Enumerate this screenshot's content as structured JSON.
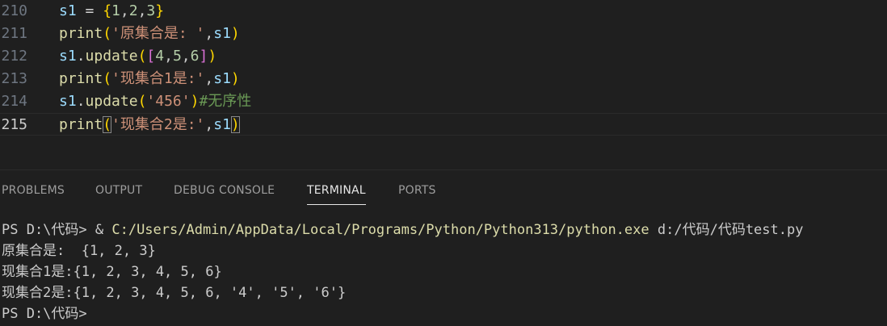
{
  "editor": {
    "lines": [
      {
        "number": "210",
        "tokens": [
          {
            "t": "s1",
            "c": "tok-var"
          },
          {
            "t": " = ",
            "c": "tok-op"
          },
          {
            "t": "{",
            "c": "tok-brace"
          },
          {
            "t": "1",
            "c": "tok-num"
          },
          {
            "t": ",",
            "c": "tok-punc"
          },
          {
            "t": "2",
            "c": "tok-num"
          },
          {
            "t": ",",
            "c": "tok-punc"
          },
          {
            "t": "3",
            "c": "tok-num"
          },
          {
            "t": "}",
            "c": "tok-brace"
          }
        ]
      },
      {
        "number": "211",
        "tokens": [
          {
            "t": "print",
            "c": "tok-fn"
          },
          {
            "t": "(",
            "c": "tok-brace"
          },
          {
            "t": "'原集合是: '",
            "c": "tok-str"
          },
          {
            "t": ",",
            "c": "tok-punc"
          },
          {
            "t": "s1",
            "c": "tok-var"
          },
          {
            "t": ")",
            "c": "tok-brace"
          }
        ]
      },
      {
        "number": "212",
        "tokens": [
          {
            "t": "s1",
            "c": "tok-var"
          },
          {
            "t": ".",
            "c": "tok-punc"
          },
          {
            "t": "update",
            "c": "tok-fn"
          },
          {
            "t": "(",
            "c": "tok-brace"
          },
          {
            "t": "[",
            "c": "tok-bracket2"
          },
          {
            "t": "4",
            "c": "tok-num"
          },
          {
            "t": ",",
            "c": "tok-punc"
          },
          {
            "t": "5",
            "c": "tok-num"
          },
          {
            "t": ",",
            "c": "tok-punc"
          },
          {
            "t": "6",
            "c": "tok-num"
          },
          {
            "t": "]",
            "c": "tok-bracket2"
          },
          {
            "t": ")",
            "c": "tok-brace"
          }
        ]
      },
      {
        "number": "213",
        "tokens": [
          {
            "t": "print",
            "c": "tok-fn"
          },
          {
            "t": "(",
            "c": "tok-brace"
          },
          {
            "t": "'现集合1是:'",
            "c": "tok-str"
          },
          {
            "t": ",",
            "c": "tok-punc"
          },
          {
            "t": "s1",
            "c": "tok-var"
          },
          {
            "t": ")",
            "c": "tok-brace"
          }
        ]
      },
      {
        "number": "214",
        "tokens": [
          {
            "t": "s1",
            "c": "tok-var"
          },
          {
            "t": ".",
            "c": "tok-punc"
          },
          {
            "t": "update",
            "c": "tok-fn"
          },
          {
            "t": "(",
            "c": "tok-brace"
          },
          {
            "t": "'456'",
            "c": "tok-str"
          },
          {
            "t": ")",
            "c": "tok-brace"
          },
          {
            "t": "#无序性",
            "c": "tok-comment"
          }
        ]
      },
      {
        "number": "215",
        "current": true,
        "tokens": [
          {
            "t": "print",
            "c": "tok-fn"
          },
          {
            "t": "(",
            "c": "tok-brace bracket-match"
          },
          {
            "t": "'现集合2是:'",
            "c": "tok-str"
          },
          {
            "t": ",",
            "c": "tok-punc"
          },
          {
            "t": "s1",
            "c": "tok-var"
          },
          {
            "t": ")",
            "c": "tok-brace bracket-match"
          }
        ]
      }
    ]
  },
  "panel": {
    "tabs": [
      {
        "label": "PROBLEMS",
        "active": false
      },
      {
        "label": "OUTPUT",
        "active": false
      },
      {
        "label": "DEBUG CONSOLE",
        "active": false
      },
      {
        "label": "TERMINAL",
        "active": true
      },
      {
        "label": "PORTS",
        "active": false
      }
    ]
  },
  "terminal": {
    "command_prompt": "PS D:\\代码> & ",
    "command_path": "C:/Users/Admin/AppData/Local/Programs/Python/Python313/python.exe",
    "command_args": " d:/代码/代码test.py",
    "output_lines": [
      "原集合是:  {1, 2, 3}",
      "现集合1是:{1, 2, 3, 4, 5, 6}",
      "现集合2是:{1, 2, 3, 4, 5, 6, '4', '5', '6'}"
    ],
    "final_prompt": "PS D:\\代码>"
  }
}
